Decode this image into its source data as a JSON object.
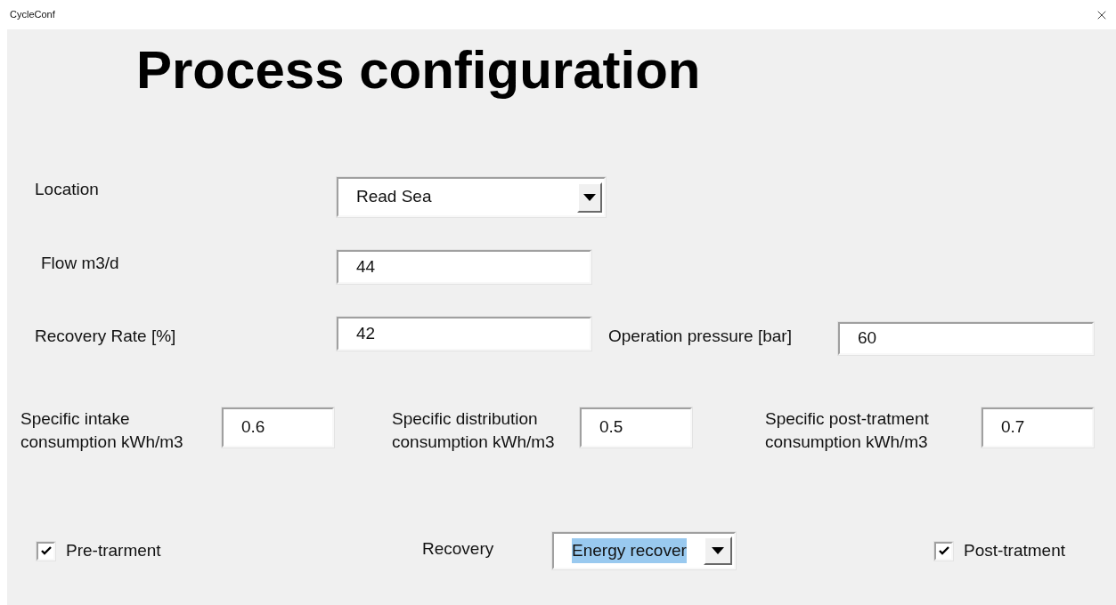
{
  "window": {
    "title": "CycleConf"
  },
  "heading": "Process configuration",
  "location": {
    "label": "Location",
    "value": "Read Sea"
  },
  "flow": {
    "label": "Flow m3/d",
    "value": "44"
  },
  "recovery_rate": {
    "label": "Recovery Rate [%]",
    "value": "42"
  },
  "operation_pressure": {
    "label": "Operation pressure [bar]",
    "value": "60"
  },
  "specific_consumption": [
    {
      "label": "Specific intake consumption kWh/m3",
      "value": "0.6"
    },
    {
      "label": "Specific distribution consumption kWh/m3",
      "value": "0.5"
    },
    {
      "label": "Specific post-tratment consumption kWh/m3",
      "value": "0.7"
    }
  ],
  "pre_treatment": {
    "label": "Pre-trarment",
    "checked": true
  },
  "recovery": {
    "label": "Recovery",
    "value": "Energy recover",
    "highlighted": true
  },
  "post_treatment": {
    "label": "Post-tratment",
    "checked": true
  }
}
